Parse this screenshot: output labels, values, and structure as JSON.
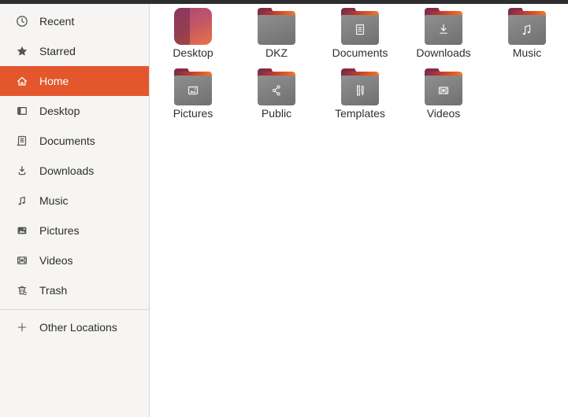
{
  "colors": {
    "accent_orange": "#E4572C",
    "topbar": "#2E2E2E",
    "sidebar_bg": "#F6F5F4",
    "sidebar_border": "#D8D6D4",
    "folder_body_gray": "#7E7E7E",
    "folder_tab_maroon": "#7B2B4D",
    "folder_back_orange": "#EF7A30",
    "main_bg": "#FFFFFF",
    "text": "#2D2D2D"
  },
  "sidebar": {
    "items": [
      {
        "label": "Recent",
        "icon": "clock-icon",
        "selected": false
      },
      {
        "label": "Starred",
        "icon": "star-icon",
        "selected": false
      },
      {
        "label": "Home",
        "icon": "home-icon",
        "selected": true
      },
      {
        "label": "Desktop",
        "icon": "desktop-icon",
        "selected": false
      },
      {
        "label": "Documents",
        "icon": "document-icon",
        "selected": false
      },
      {
        "label": "Downloads",
        "icon": "download-icon",
        "selected": false
      },
      {
        "label": "Music",
        "icon": "music-note-icon",
        "selected": false
      },
      {
        "label": "Pictures",
        "icon": "picture-icon",
        "selected": false
      },
      {
        "label": "Videos",
        "icon": "film-icon",
        "selected": false
      },
      {
        "label": "Trash",
        "icon": "trash-icon",
        "selected": false
      }
    ],
    "footer_item": {
      "label": "Other Locations",
      "icon": "plus-icon"
    }
  },
  "main": {
    "view": "icon-grid",
    "items": [
      {
        "label": "Desktop",
        "icon": "desktop-gradient-folder"
      },
      {
        "label": "DKZ",
        "icon": "plain-folder"
      },
      {
        "label": "Documents",
        "icon": "folder-document-emblem"
      },
      {
        "label": "Downloads",
        "icon": "folder-download-emblem"
      },
      {
        "label": "Music",
        "icon": "folder-music-emblem"
      },
      {
        "label": "Pictures",
        "icon": "folder-image-emblem"
      },
      {
        "label": "Public",
        "icon": "folder-share-emblem"
      },
      {
        "label": "Templates",
        "icon": "folder-template-emblem"
      },
      {
        "label": "Videos",
        "icon": "folder-film-emblem"
      }
    ]
  }
}
